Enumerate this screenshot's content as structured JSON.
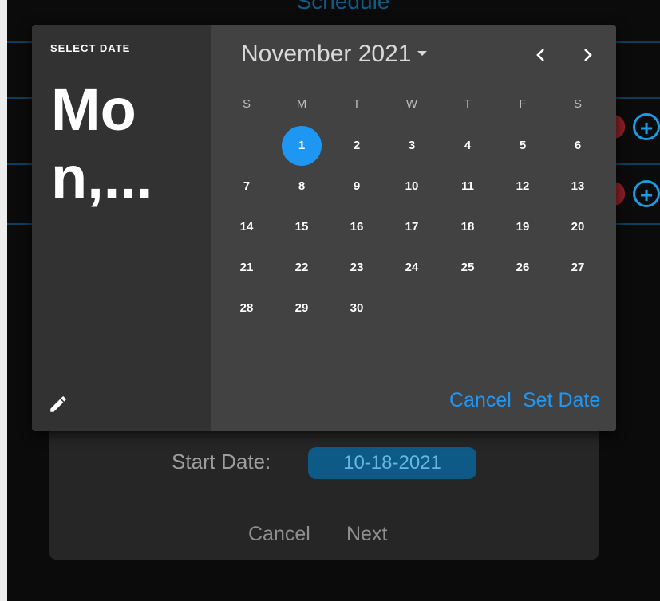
{
  "background": {
    "title": "Schedule",
    "start_date_label": "Start Date:",
    "start_date_value": "10-18-2021",
    "cancel_label": "Cancel",
    "next_label": "Next"
  },
  "picker": {
    "select_label": "SELECT DATE",
    "headline": "Mon,...",
    "month_label": "November 2021",
    "weekdays": [
      "S",
      "M",
      "T",
      "W",
      "T",
      "F",
      "S"
    ],
    "selected_day": "1",
    "weeks": [
      [
        "",
        "1",
        "2",
        "3",
        "4",
        "5",
        "6"
      ],
      [
        "7",
        "8",
        "9",
        "10",
        "11",
        "12",
        "13"
      ],
      [
        "14",
        "15",
        "16",
        "17",
        "18",
        "19",
        "20"
      ],
      [
        "21",
        "22",
        "23",
        "24",
        "25",
        "26",
        "27"
      ],
      [
        "28",
        "29",
        "30",
        "",
        "",
        "",
        ""
      ]
    ],
    "cancel_label": "Cancel",
    "set_label": "Set Date",
    "icons": {
      "month_dropdown": "caret-down-icon",
      "prev": "chevron-left-icon",
      "next": "chevron-right-icon",
      "edit": "pencil-icon"
    }
  },
  "colors": {
    "accent": "#2196f3",
    "selected_day": "#1e97f3",
    "picker_bg": "#424242",
    "header_bg": "#323232"
  }
}
